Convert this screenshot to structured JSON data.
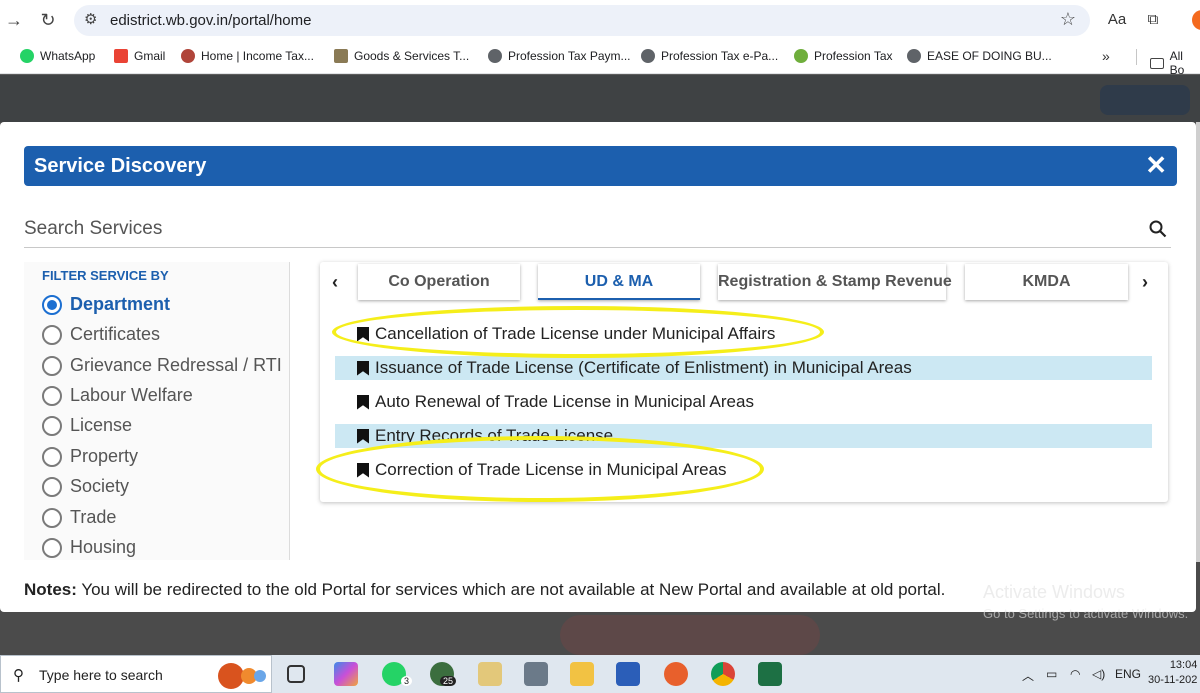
{
  "browser": {
    "url": "edistrict.wb.gov.in/portal/home",
    "bookmarks": [
      {
        "label": "WhatsApp",
        "color": "#25d366"
      },
      {
        "label": "Gmail",
        "color": "#ea4335"
      },
      {
        "label": "Home | Income Tax...",
        "color": "#b0453a"
      },
      {
        "label": "Goods & Services T...",
        "color": "#8a7a55"
      },
      {
        "label": "Profession Tax Paym...",
        "color": "#5f6368"
      },
      {
        "label": "Profession Tax e-Pa...",
        "color": "#5f6368"
      },
      {
        "label": "Profession Tax",
        "color": "#6fae3c"
      },
      {
        "label": "EASE OF DOING BU...",
        "color": "#5f6368"
      }
    ],
    "bookmarks_more": "»",
    "all_bookmarks": "All Bo"
  },
  "modal": {
    "title": "Service Discovery",
    "search_placeholder": "Search Services",
    "filter_title": "FILTER SERVICE BY",
    "filters": [
      {
        "label": "Department",
        "selected": true
      },
      {
        "label": "Certificates",
        "selected": false
      },
      {
        "label": "Grievance Redressal / RTI",
        "selected": false
      },
      {
        "label": "Labour Welfare",
        "selected": false
      },
      {
        "label": "License",
        "selected": false
      },
      {
        "label": "Property",
        "selected": false
      },
      {
        "label": "Society",
        "selected": false
      },
      {
        "label": "Trade",
        "selected": false
      },
      {
        "label": "Housing",
        "selected": false
      }
    ],
    "tabs": [
      {
        "label": "Co Operation",
        "active": false
      },
      {
        "label": "UD & MA",
        "active": true
      },
      {
        "label": "Registration & Stamp Revenue",
        "active": false
      },
      {
        "label": "KMDA",
        "active": false
      }
    ],
    "services": [
      "Cancellation of Trade License under Municipal Affairs",
      "Issuance of Trade License (Certificate of Enlistment) in Municipal Areas",
      "Auto Renewal of Trade License in Municipal Areas",
      "Entry Records of Trade License",
      "Correction of Trade License in Municipal Areas"
    ],
    "notes_label": "Notes:",
    "notes_text": " You will be redirected to the old Portal for services which are not available at New Portal and available at old portal."
  },
  "watermark": {
    "line1": "Activate Windows",
    "line2": "Go to Settings to activate Windows."
  },
  "taskbar": {
    "search_placeholder": "Type here to search",
    "whatsapp_badge": "3",
    "app_badge": "25",
    "language": "ENG",
    "time": "13:04",
    "date": "30-11-202"
  },
  "colors": {
    "header": "#1c5fae",
    "row_alt": "#cce8f3",
    "highlight": "#f5ee1a"
  }
}
